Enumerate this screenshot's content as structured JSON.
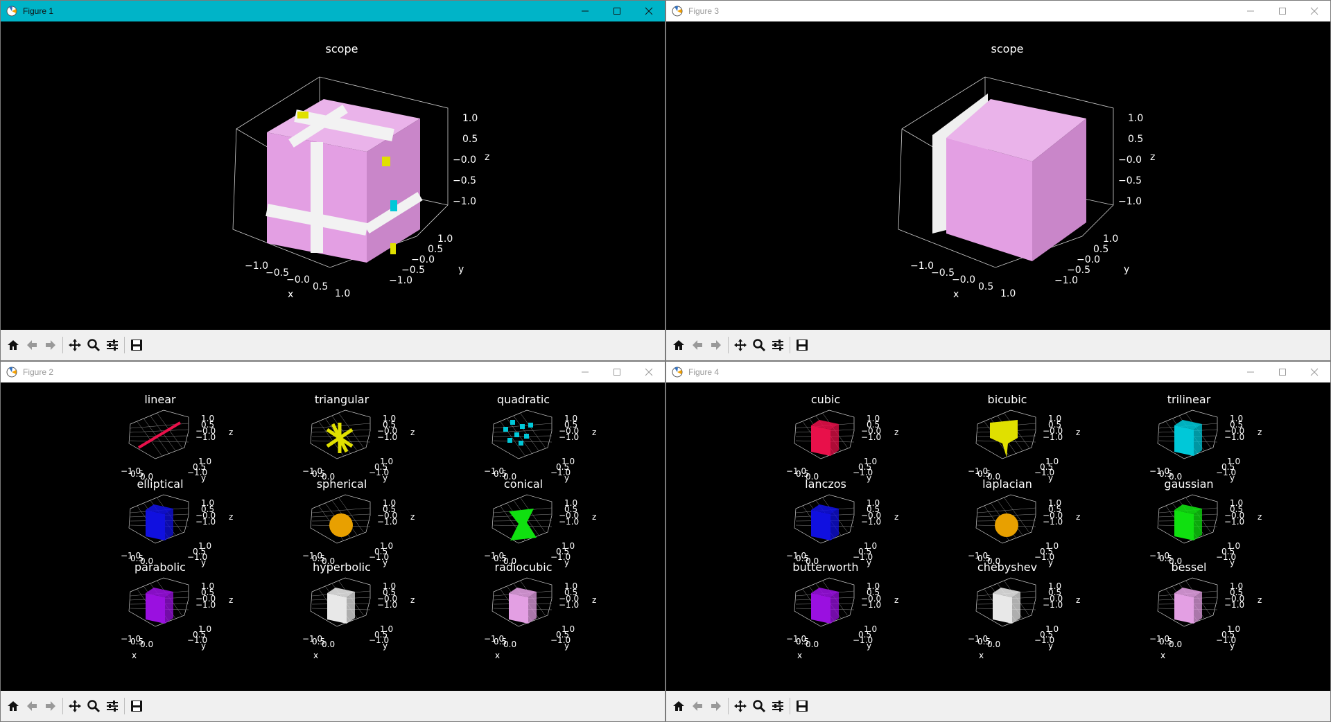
{
  "figures": {
    "f1": {
      "title": "Figure 1"
    },
    "f2": {
      "title": "Figure 2"
    },
    "f3": {
      "title": "Figure 3"
    },
    "f4": {
      "title": "Figure 4"
    }
  },
  "scope": {
    "title": "scope",
    "x_ticks": [
      "−1.0",
      "−0.5",
      "−0.0",
      "0.5",
      "1.0"
    ],
    "y_ticks": [
      "1.0",
      "0.5",
      "−0.0",
      "−0.5",
      "−1.0"
    ],
    "z_ticks": [
      "1.0",
      "0.5",
      "−0.0",
      "−0.5",
      "−1.0"
    ],
    "xlabel": "x",
    "ylabel": "y",
    "zlabel": "z"
  },
  "grid_fig2": [
    "linear",
    "triangular",
    "quadratic",
    "elliptical",
    "spherical",
    "conical",
    "parabolic",
    "hyperbolic",
    "radiocubic"
  ],
  "grid_fig4": [
    "cubic",
    "bicubic",
    "trilinear",
    "lanczos",
    "laplacian",
    "gaussian",
    "butterworth",
    "chebyshev",
    "bessel"
  ],
  "small_axis": {
    "z_ticks": [
      "1.0",
      "0.5",
      "−0.0",
      "−1.0"
    ],
    "y_ticks": [
      "1.0",
      "0.5",
      "−1.0"
    ],
    "x_ticks": [
      "−1.0",
      "0.5",
      "0.0"
    ],
    "xlabel": "x",
    "ylabel": "y",
    "zlabel": "z"
  },
  "colors": {
    "pink": "#e39fe3",
    "white": "#e8e8e8",
    "yellow": "#e0e000",
    "cyan": "#00c8d8",
    "red": "#e8104a",
    "blue": "#1010e0",
    "orange": "#e8a000",
    "green": "#10e010",
    "purple": "#9a10e0",
    "titlebar_active": "#00b4c8"
  },
  "toolbar": {
    "icons": [
      "home-icon",
      "back-arrow-icon",
      "forward-arrow-icon",
      "pan-icon",
      "zoom-icon",
      "configure-icon",
      "save-icon"
    ]
  }
}
